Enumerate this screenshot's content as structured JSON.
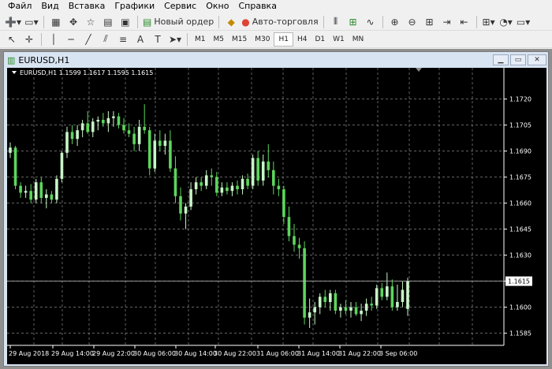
{
  "menu": [
    "Файл",
    "Вид",
    "Вставка",
    "Графики",
    "Сервис",
    "Окно",
    "Справка"
  ],
  "toolbar": {
    "new_order": "Новый ордер",
    "auto_trading": "Авто-торговля"
  },
  "timeframes": [
    "M1",
    "M5",
    "M15",
    "M30",
    "H1",
    "H4",
    "D1",
    "W1",
    "MN"
  ],
  "selected_timeframe": "H1",
  "window": {
    "title": "EURUSD,H1"
  },
  "chart_header": "EURUSD,H1  1.1599 1.1617 1.1595 1.1615",
  "colors": {
    "background": "#000000",
    "grid": "#a0a0a0",
    "bull": "#c8f5c8",
    "bear": "#5cd65c",
    "text": "#ffffff"
  },
  "chart_data": {
    "type": "candlestick",
    "symbol": "EURUSD",
    "period": "H1",
    "ylim": [
      1.1578,
      1.1738
    ],
    "yticks": [
      "1.1720",
      "1.1705",
      "1.1690",
      "1.1675",
      "1.1660",
      "1.1645",
      "1.1630",
      "1.1615",
      "1.1600",
      "1.1585"
    ],
    "xticks": [
      "29 Aug 2018",
      "29 Aug 14:00",
      "29 Aug 22:00",
      "30 Aug 06:00",
      "30 Aug 14:00",
      "30 Aug 22:00",
      "31 Aug 06:00",
      "31 Aug 14:00",
      "31 Aug 22:00",
      "3 Sep 06:00"
    ],
    "current_price": "1.1615",
    "candles": [
      [
        1.1689,
        1.1695,
        1.1686,
        1.1692
      ],
      [
        1.1692,
        1.1693,
        1.1668,
        1.167
      ],
      [
        1.167,
        1.1672,
        1.1663,
        1.1666
      ],
      [
        1.1666,
        1.167,
        1.1663,
        1.1667
      ],
      [
        1.1667,
        1.1671,
        1.166,
        1.1662
      ],
      [
        1.1662,
        1.1674,
        1.166,
        1.1672
      ],
      [
        1.1672,
        1.1675,
        1.166,
        1.1663
      ],
      [
        1.1663,
        1.1668,
        1.1657,
        1.1665
      ],
      [
        1.1665,
        1.1667,
        1.166,
        1.1662
      ],
      [
        1.1662,
        1.1676,
        1.166,
        1.1674
      ],
      [
        1.1674,
        1.169,
        1.1672,
        1.1689
      ],
      [
        1.1689,
        1.1704,
        1.1686,
        1.1701
      ],
      [
        1.1701,
        1.1705,
        1.1694,
        1.1697
      ],
      [
        1.1697,
        1.1705,
        1.1693,
        1.1702
      ],
      [
        1.1702,
        1.1708,
        1.1698,
        1.1706
      ],
      [
        1.1706,
        1.1713,
        1.17,
        1.1701
      ],
      [
        1.1701,
        1.1709,
        1.1698,
        1.1707
      ],
      [
        1.1707,
        1.171,
        1.1702,
        1.1708
      ],
      [
        1.1708,
        1.1712,
        1.1704,
        1.1706
      ],
      [
        1.1706,
        1.1713,
        1.1701,
        1.1709
      ],
      [
        1.1709,
        1.1713,
        1.1704,
        1.171
      ],
      [
        1.171,
        1.1712,
        1.1703,
        1.1705
      ],
      [
        1.1705,
        1.1709,
        1.17,
        1.1702
      ],
      [
        1.1702,
        1.1706,
        1.1698,
        1.17
      ],
      [
        1.17,
        1.1704,
        1.169,
        1.1694
      ],
      [
        1.1694,
        1.1708,
        1.169,
        1.1704
      ],
      [
        1.1704,
        1.1717,
        1.17,
        1.1702
      ],
      [
        1.1702,
        1.1704,
        1.1676,
        1.168
      ],
      [
        1.168,
        1.17,
        1.1678,
        1.1696
      ],
      [
        1.1696,
        1.1702,
        1.169,
        1.1693
      ],
      [
        1.1693,
        1.17,
        1.1688,
        1.1696
      ],
      [
        1.1696,
        1.1702,
        1.1678,
        1.168
      ],
      [
        1.168,
        1.1687,
        1.166,
        1.1664
      ],
      [
        1.1664,
        1.1669,
        1.165,
        1.1654
      ],
      [
        1.1654,
        1.166,
        1.1645,
        1.1658
      ],
      [
        1.1658,
        1.1672,
        1.1656,
        1.1668
      ],
      [
        1.1668,
        1.1675,
        1.1665,
        1.1672
      ],
      [
        1.1672,
        1.1675,
        1.1667,
        1.167
      ],
      [
        1.167,
        1.1679,
        1.1668,
        1.1676
      ],
      [
        1.1676,
        1.168,
        1.167,
        1.1675
      ],
      [
        1.1675,
        1.1678,
        1.1664,
        1.1666
      ],
      [
        1.1666,
        1.1672,
        1.1664,
        1.1669
      ],
      [
        1.1669,
        1.1672,
        1.1665,
        1.1667
      ],
      [
        1.1667,
        1.1672,
        1.1664,
        1.167
      ],
      [
        1.167,
        1.1673,
        1.1665,
        1.1668
      ],
      [
        1.1668,
        1.1676,
        1.1665,
        1.1674
      ],
      [
        1.1674,
        1.1677,
        1.1668,
        1.167
      ],
      [
        1.167,
        1.1688,
        1.1668,
        1.1686
      ],
      [
        1.1686,
        1.169,
        1.167,
        1.1673
      ],
      [
        1.1673,
        1.1688,
        1.167,
        1.1684
      ],
      [
        1.1684,
        1.1694,
        1.1675,
        1.1679
      ],
      [
        1.1679,
        1.1684,
        1.1665,
        1.167
      ],
      [
        1.167,
        1.1674,
        1.1664,
        1.1668
      ],
      [
        1.1668,
        1.167,
        1.1648,
        1.1652
      ],
      [
        1.1652,
        1.1658,
        1.1638,
        1.1641
      ],
      [
        1.1641,
        1.1648,
        1.1632,
        1.1636
      ],
      [
        1.1636,
        1.164,
        1.1628,
        1.1634
      ],
      [
        1.1634,
        1.1638,
        1.159,
        1.1594
      ],
      [
        1.1594,
        1.1605,
        1.1588,
        1.1597
      ],
      [
        1.1597,
        1.1603,
        1.159,
        1.16
      ],
      [
        1.16,
        1.1608,
        1.1596,
        1.1606
      ],
      [
        1.1606,
        1.161,
        1.16,
        1.1603
      ],
      [
        1.1603,
        1.161,
        1.1598,
        1.1608
      ],
      [
        1.1608,
        1.161,
        1.1596,
        1.1598
      ],
      [
        1.1598,
        1.1602,
        1.1594,
        1.16
      ],
      [
        1.16,
        1.1604,
        1.1596,
        1.1598
      ],
      [
        1.1598,
        1.1603,
        1.1594,
        1.16
      ],
      [
        1.16,
        1.1603,
        1.1595,
        1.1596
      ],
      [
        1.1596,
        1.1602,
        1.1592,
        1.1598
      ],
      [
        1.1598,
        1.1605,
        1.1595,
        1.1602
      ],
      [
        1.1602,
        1.1606,
        1.1598,
        1.1601
      ],
      [
        1.1601,
        1.1613,
        1.1599,
        1.1611
      ],
      [
        1.1611,
        1.1614,
        1.1604,
        1.1606
      ],
      [
        1.1606,
        1.162,
        1.1604,
        1.1612
      ],
      [
        1.1612,
        1.1616,
        1.1598,
        1.16
      ],
      [
        1.16,
        1.1613,
        1.1598,
        1.1603
      ],
      [
        1.1603,
        1.1615,
        1.16,
        1.161
      ],
      [
        1.1599,
        1.1617,
        1.1595,
        1.1615
      ]
    ]
  }
}
